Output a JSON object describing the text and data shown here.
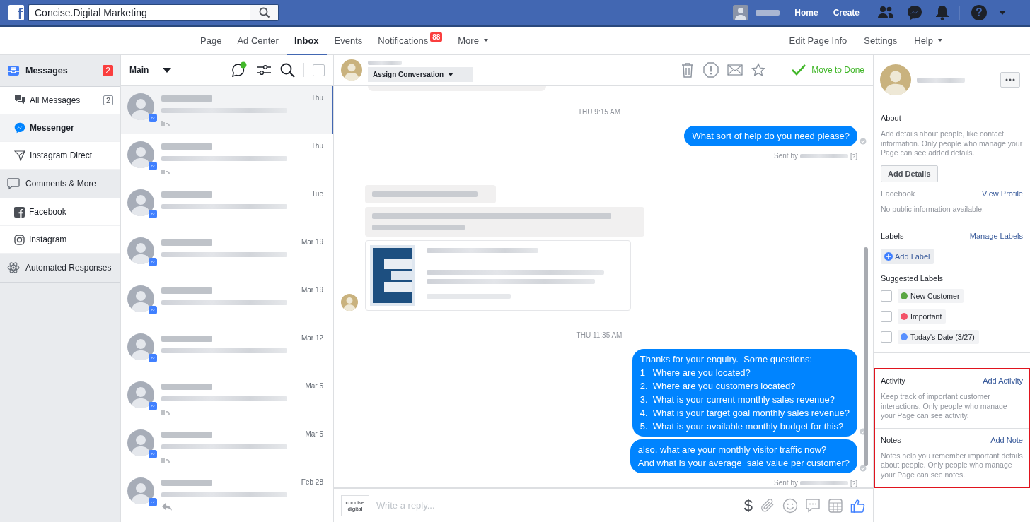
{
  "topbar": {
    "logo": "f",
    "search": {
      "value": "Concise.Digital Marketing"
    },
    "links": [
      "Home",
      "Create"
    ],
    "help": "?"
  },
  "nav": {
    "left": [
      {
        "label": "Page",
        "selected": false,
        "dropdown": false
      },
      {
        "label": "Ad Center",
        "selected": false,
        "dropdown": false
      },
      {
        "label": "Inbox",
        "selected": true,
        "dropdown": false
      },
      {
        "label": "Events",
        "selected": false,
        "dropdown": false
      },
      {
        "label": "Notifications",
        "selected": false,
        "dropdown": false,
        "badge": "88"
      },
      {
        "label": "More",
        "selected": false,
        "dropdown": true
      }
    ],
    "right": [
      {
        "label": "Edit Page Info",
        "dropdown": false
      },
      {
        "label": "Settings",
        "dropdown": false
      },
      {
        "label": "Help",
        "dropdown": true
      }
    ]
  },
  "sidebar": [
    {
      "kind": "header",
      "label": "Messages",
      "active": true,
      "badge": "2"
    },
    {
      "kind": "item",
      "label": "All Messages",
      "selected": false,
      "count": "2"
    },
    {
      "kind": "item",
      "label": "Messenger",
      "selected": true
    },
    {
      "kind": "item",
      "label": "Instagram Direct",
      "selected": false
    },
    {
      "kind": "header",
      "label": "Comments & More",
      "active": false
    },
    {
      "kind": "item",
      "label": "Facebook",
      "selected": false
    },
    {
      "kind": "item",
      "label": "Instagram",
      "selected": false
    },
    {
      "kind": "header",
      "label": "Automated Responses",
      "active": false
    }
  ],
  "conversation_list": {
    "folder": "Main",
    "conversations": [
      {
        "kind": "seen",
        "time": "Thu",
        "selected": true
      },
      {
        "kind": "seen",
        "time": "Thu",
        "selected": false
      },
      {
        "kind": "plain",
        "time": "Tue",
        "selected": false
      },
      {
        "kind": "plain",
        "time": "Mar 19",
        "selected": false
      },
      {
        "kind": "plain",
        "time": "Mar 19",
        "selected": false
      },
      {
        "kind": "plain",
        "time": "Mar 12",
        "selected": false
      },
      {
        "kind": "seen",
        "time": "Mar 5",
        "selected": false
      },
      {
        "kind": "seen",
        "time": "Mar 5",
        "selected": false
      },
      {
        "kind": "replied",
        "time": "Feb 28",
        "selected": false
      }
    ],
    "select_all": {
      "checked": false
    }
  },
  "chat": {
    "assign": "Assign Conversation",
    "done": "Move to Done",
    "messages": [
      {
        "kind": "cut_bubble"
      },
      {
        "kind": "time",
        "text": "THU 9:15 AM"
      },
      {
        "kind": "outgoing",
        "text": "What sort of help do you need please?"
      },
      {
        "kind": "sent_by",
        "prefix": "Sent by",
        "help": "[?]"
      },
      {
        "kind": "incoming_short",
        "avatar": false
      },
      {
        "kind": "incoming_long",
        "avatar": false
      },
      {
        "kind": "link_card",
        "avatar": true
      },
      {
        "kind": "time",
        "text": "THU 11:35 AM"
      },
      {
        "kind": "outgoing",
        "text": "Thanks for your enquiry.  Some questions:\n1   Where are you located?\n2.  Where are you customers located?\n3.  What is your current monthly sales revenue?\n4.  What is your target goal monthly sales revenue?\n5.  What is your available monthly budget for this?"
      },
      {
        "kind": "outgoing",
        "text": "also, what are your monthly visitor traffic now?\nAnd what is your average  sale value per customer?"
      },
      {
        "kind": "sent_by",
        "prefix": "Sent by",
        "help": "[?]"
      }
    ],
    "composer": {
      "logo": [
        "concise",
        "digital"
      ],
      "placeholder": "Write a reply...",
      "currency": "$"
    }
  },
  "details": {
    "about": {
      "title": "About",
      "text": "Add details about people, like contact information. Only people who manage your Page can see added details.",
      "button": "Add Details",
      "facebook_label": "Facebook",
      "view_profile": "View Profile",
      "no_info": "No public information available."
    },
    "labels": {
      "title": "Labels",
      "manage": "Manage Labels",
      "add": "Add Label",
      "suggested_title": "Suggested Labels",
      "suggested": [
        {
          "label": "New Customer",
          "color": "#5aa743",
          "checked": false
        },
        {
          "label": "Important",
          "color": "#f35369",
          "checked": false
        },
        {
          "label": "Today's Date (3/27)",
          "color": "#5890ff",
          "checked": false
        }
      ]
    },
    "highlight": {
      "on": true,
      "sections": [
        {
          "title": "Activity",
          "action": "Add Activity",
          "text": "Keep track of important customer interactions. Only people who manage your Page can see activity."
        },
        {
          "title": "Notes",
          "action": "Add Note",
          "text": "Notes help you remember important details about people. Only people who manage your Page can see notes."
        }
      ]
    }
  }
}
